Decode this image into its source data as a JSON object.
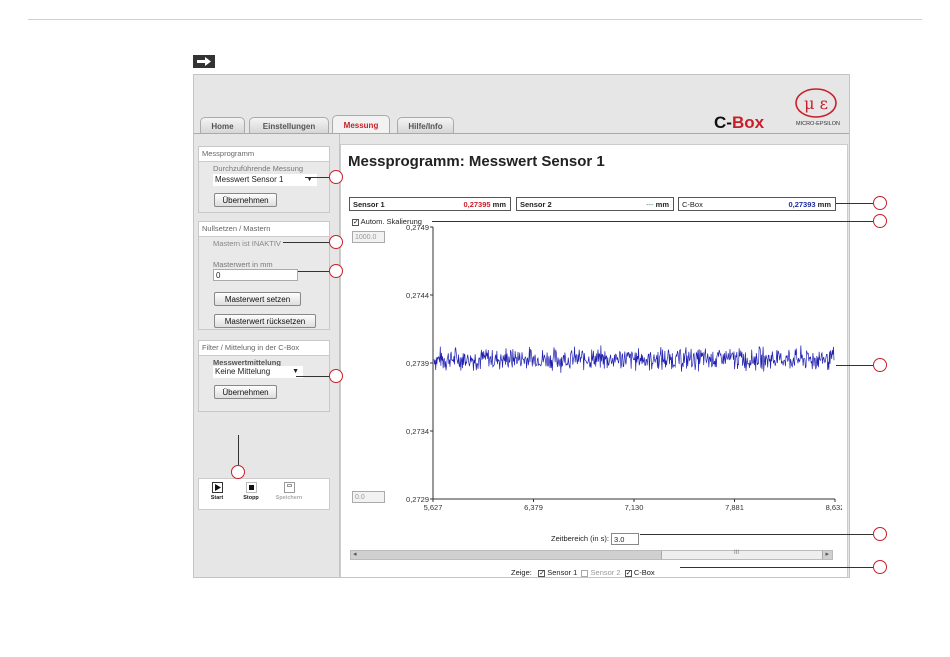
{
  "tabs": [
    {
      "label": "Home",
      "active": false
    },
    {
      "label": "Einstellungen",
      "active": false
    },
    {
      "label": "Messung",
      "active": true
    },
    {
      "label": "Hilfe/Info",
      "active": false
    }
  ],
  "brand": {
    "prefix": "C-",
    "suffix": "Box",
    "logo_text": "MICRO-EPSILON",
    "logo_mark": "μ ε"
  },
  "sidebar": {
    "messprogramm": {
      "title": "Messprogramm",
      "label": "Durchzuführende Messung",
      "selected": "Messwert Sensor 1",
      "apply": "Übernehmen"
    },
    "mastern": {
      "title": "Nullsetzen / Mastern",
      "status": "Mastern ist INAKTIV",
      "master_label": "Masterwert in mm",
      "master_value": "0",
      "set_button": "Masterwert setzen",
      "reset_button": "Masterwert rücksetzen"
    },
    "filter": {
      "title": "Filter / Mittelung in der C-Box",
      "label": "Messwertmittelung",
      "selected": "Keine Mittelung",
      "apply": "Übernehmen"
    },
    "tools": [
      {
        "label": "Start",
        "icon": "play-icon"
      },
      {
        "label": "Stopp",
        "icon": "stop-icon"
      },
      {
        "label": "Speichern",
        "icon": "save-icon"
      }
    ]
  },
  "main": {
    "title": "Messprogramm: Messwert Sensor 1",
    "readouts": [
      {
        "name": "Sensor 1",
        "value": "0,27395",
        "unit": "mm",
        "color": "#c8202a"
      },
      {
        "name": "Sensor 2",
        "value": "---",
        "unit": "mm",
        "color": "#2e8b57"
      },
      {
        "name": "C-Box",
        "value": "0,27393",
        "unit": "mm",
        "color": "#1f2fa0"
      }
    ],
    "auto_scale": {
      "label": "Autom. Skalierung",
      "checked": true
    },
    "y_max_input": "1000.0",
    "y_min_input": "0.0",
    "time_range_label": "Zeitbereich (in s):",
    "time_range_value": "3.0",
    "scroll_grip": "III",
    "show_label": "Zeige:",
    "show": [
      {
        "label": "Sensor 1",
        "checked": true,
        "enabled": true
      },
      {
        "label": "Sensor 2",
        "checked": false,
        "enabled": false
      },
      {
        "label": "C-Box",
        "checked": true,
        "enabled": true
      }
    ]
  },
  "chart_data": {
    "type": "line",
    "x_ticks": [
      "5,627",
      "6,379",
      "7,130",
      "7,881",
      "8,632"
    ],
    "y_ticks": [
      "0,2749",
      "0,2744",
      "0,2739",
      "0,2734",
      "0,2729"
    ],
    "xlim": [
      5.627,
      8.632
    ],
    "ylim": [
      0.2729,
      0.2749
    ],
    "series": [
      {
        "color": "#1f1fb0",
        "mean": 0.27393,
        "noise": 7e-05
      }
    ]
  }
}
